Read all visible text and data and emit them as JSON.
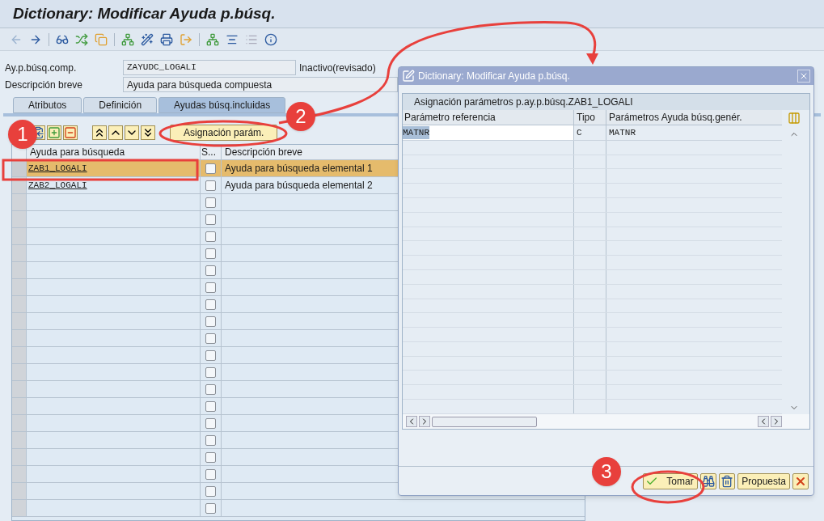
{
  "window": {
    "title": "Dictionary: Modificar Ayuda p.búsq."
  },
  "header_fields": [
    {
      "label": "Ay.p.búsq.comp.",
      "value": "ZAYUDC_LOGALI",
      "status": "Inactivo(revisado)"
    },
    {
      "label": "Descripción breve",
      "value": "Ayuda para búsqueda compuesta"
    }
  ],
  "tabs": [
    {
      "label": "Atributos",
      "selected": false
    },
    {
      "label": "Definición",
      "selected": false
    },
    {
      "label": "Ayudas búsq.incluidas",
      "selected": true
    }
  ],
  "table_toolbar": {
    "assign_button": "Asignación parám."
  },
  "table": {
    "columns": [
      "Ayuda para búsqueda",
      "S...",
      "Descripción breve"
    ],
    "rows": [
      {
        "name": "ZAB1_LOGALI",
        "description": "Ayuda para búsqueda elemental 1",
        "checked": false,
        "selected": true
      },
      {
        "name": "ZAB2_LOGALI",
        "description": "Ayuda para búsqueda elemental 2",
        "checked": false,
        "selected": false
      },
      {
        "checked": false,
        "selected": false
      },
      {
        "checked": false,
        "selected": false
      },
      {
        "checked": false,
        "selected": false
      },
      {
        "checked": false,
        "selected": false
      },
      {
        "checked": false,
        "selected": false
      },
      {
        "checked": false,
        "selected": false
      },
      {
        "checked": false,
        "selected": false
      },
      {
        "checked": false,
        "selected": false
      },
      {
        "checked": false,
        "selected": false
      },
      {
        "checked": false,
        "selected": false
      },
      {
        "checked": false,
        "selected": false
      },
      {
        "checked": false,
        "selected": false
      },
      {
        "checked": false,
        "selected": false
      },
      {
        "checked": false,
        "selected": false
      },
      {
        "checked": false,
        "selected": false
      },
      {
        "checked": false,
        "selected": false
      },
      {
        "checked": false,
        "selected": false
      },
      {
        "checked": false,
        "selected": false
      },
      {
        "checked": false,
        "selected": false
      }
    ]
  },
  "dialog": {
    "title": "Dictionary: Modificar Ayuda p.búsq.",
    "section_title": "Asignación parámetros p.ay.p.búsq.ZAB1_LOGALI",
    "columns": [
      "Parámetro referencia",
      "Tipo",
      "Parámetros Ayuda búsq.genér."
    ],
    "rows": [
      {
        "reference": "MATNR",
        "type": "C",
        "parameter": "MATNR"
      }
    ],
    "buttons": [
      {
        "kind": "take",
        "label": "Tomar"
      },
      {
        "kind": "find"
      },
      {
        "kind": "delete"
      },
      {
        "kind": "text",
        "label": "Propuesta"
      },
      {
        "kind": "cancel"
      }
    ]
  },
  "annotations": [
    "1",
    "2",
    "3"
  ]
}
